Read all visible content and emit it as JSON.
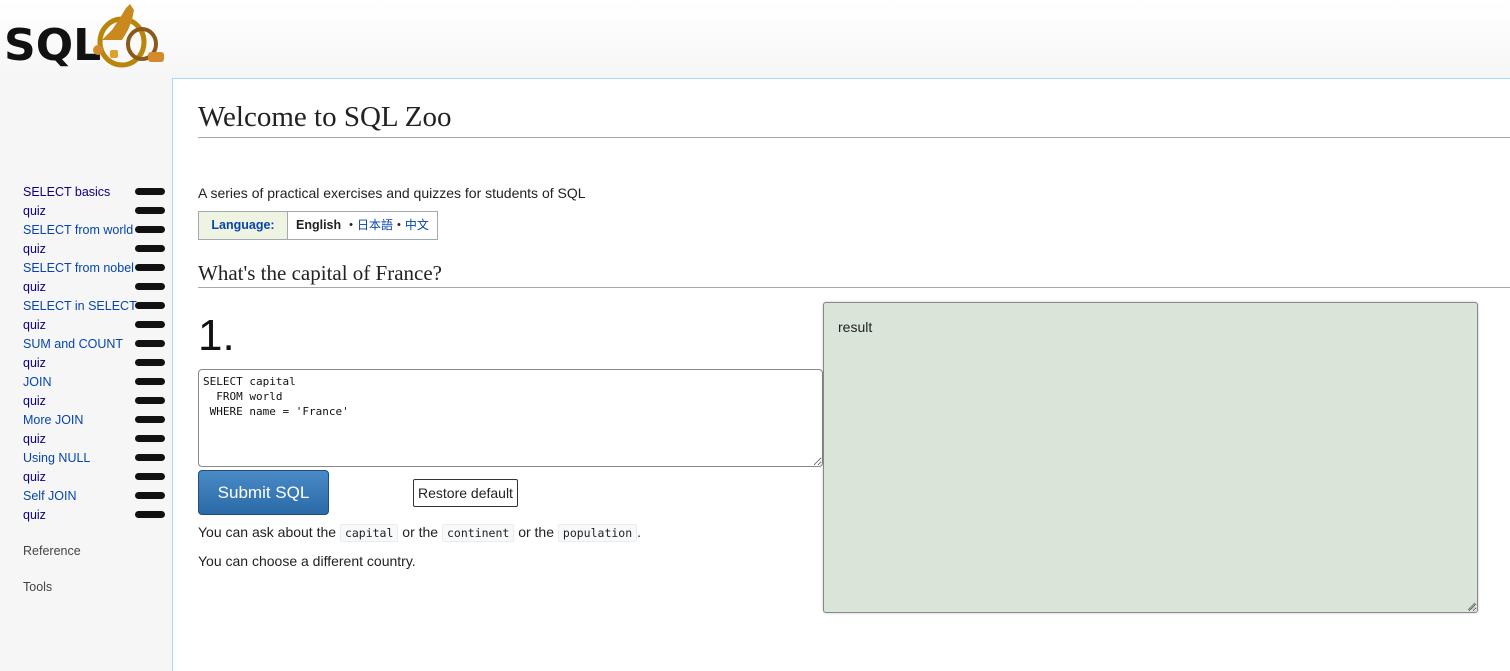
{
  "header": {
    "logo_text": "SQLZOO"
  },
  "sidebar": {
    "items": [
      {
        "label": "SELECT basics",
        "kind": "tutorial"
      },
      {
        "label": "quiz",
        "kind": "quiz"
      },
      {
        "label": "SELECT from world",
        "kind": "tutorial"
      },
      {
        "label": "quiz",
        "kind": "quiz"
      },
      {
        "label": "SELECT from nobel",
        "kind": "tutorial"
      },
      {
        "label": "quiz",
        "kind": "quiz"
      },
      {
        "label": "SELECT in SELECT",
        "kind": "tutorial"
      },
      {
        "label": "quiz",
        "kind": "quiz"
      },
      {
        "label": "SUM and COUNT",
        "kind": "tutorial"
      },
      {
        "label": "quiz",
        "kind": "quiz"
      },
      {
        "label": "JOIN",
        "kind": "tutorial"
      },
      {
        "label": "quiz",
        "kind": "quiz"
      },
      {
        "label": "More JOIN",
        "kind": "tutorial"
      },
      {
        "label": "quiz",
        "kind": "quiz"
      },
      {
        "label": "Using NULL",
        "kind": "tutorial"
      },
      {
        "label": "quiz",
        "kind": "quiz"
      },
      {
        "label": "Self JOIN",
        "kind": "tutorial"
      },
      {
        "label": "quiz",
        "kind": "quiz"
      }
    ],
    "reference_label": "Reference",
    "tools_label": "Tools"
  },
  "main": {
    "title": "Welcome to SQL Zoo",
    "subtitle": "A series of practical exercises and quizzes for students of SQL",
    "language": {
      "label": "Language:",
      "current": "English",
      "separator": "•",
      "options": [
        "日本語",
        "中文"
      ]
    },
    "section_heading": "What's the capital of France?",
    "question_number": "1.",
    "editor_sql": "SELECT capital\n  FROM world\n WHERE name = 'France'",
    "submit_label": "Submit SQL",
    "restore_label": "Restore default",
    "hint1": {
      "prefix": "You can ask about the",
      "code1": "capital",
      "mid1": "or the",
      "code2": "continent",
      "mid2": "or the",
      "code3": "population",
      "suffix": "."
    },
    "hint2": "You can choose a different country.",
    "result_label": "result"
  },
  "colors": {
    "progress_pill": "#111111",
    "result_bg": "#dae5da",
    "submit_bg": "#2a6aa6",
    "link": "#0645ad"
  }
}
